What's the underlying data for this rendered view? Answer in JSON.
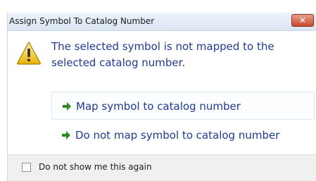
{
  "dialog": {
    "title": "Assign Symbol To Catalog Number",
    "close_icon": "close-icon",
    "warning_icon": "warning-icon",
    "message": "The selected symbol is not mapped to the selected catalog number.",
    "options": [
      {
        "label": "Map symbol to catalog number",
        "icon": "green-arrow-icon"
      },
      {
        "label": "Do not map symbol to catalog number",
        "icon": "green-arrow-icon"
      }
    ],
    "footer": {
      "checkbox_label": "Do not show me this again",
      "checked": false
    },
    "colors": {
      "link_text": "#1f3a9a",
      "arrow": "#2e8b1f",
      "close_button": "#c74a2f"
    }
  }
}
